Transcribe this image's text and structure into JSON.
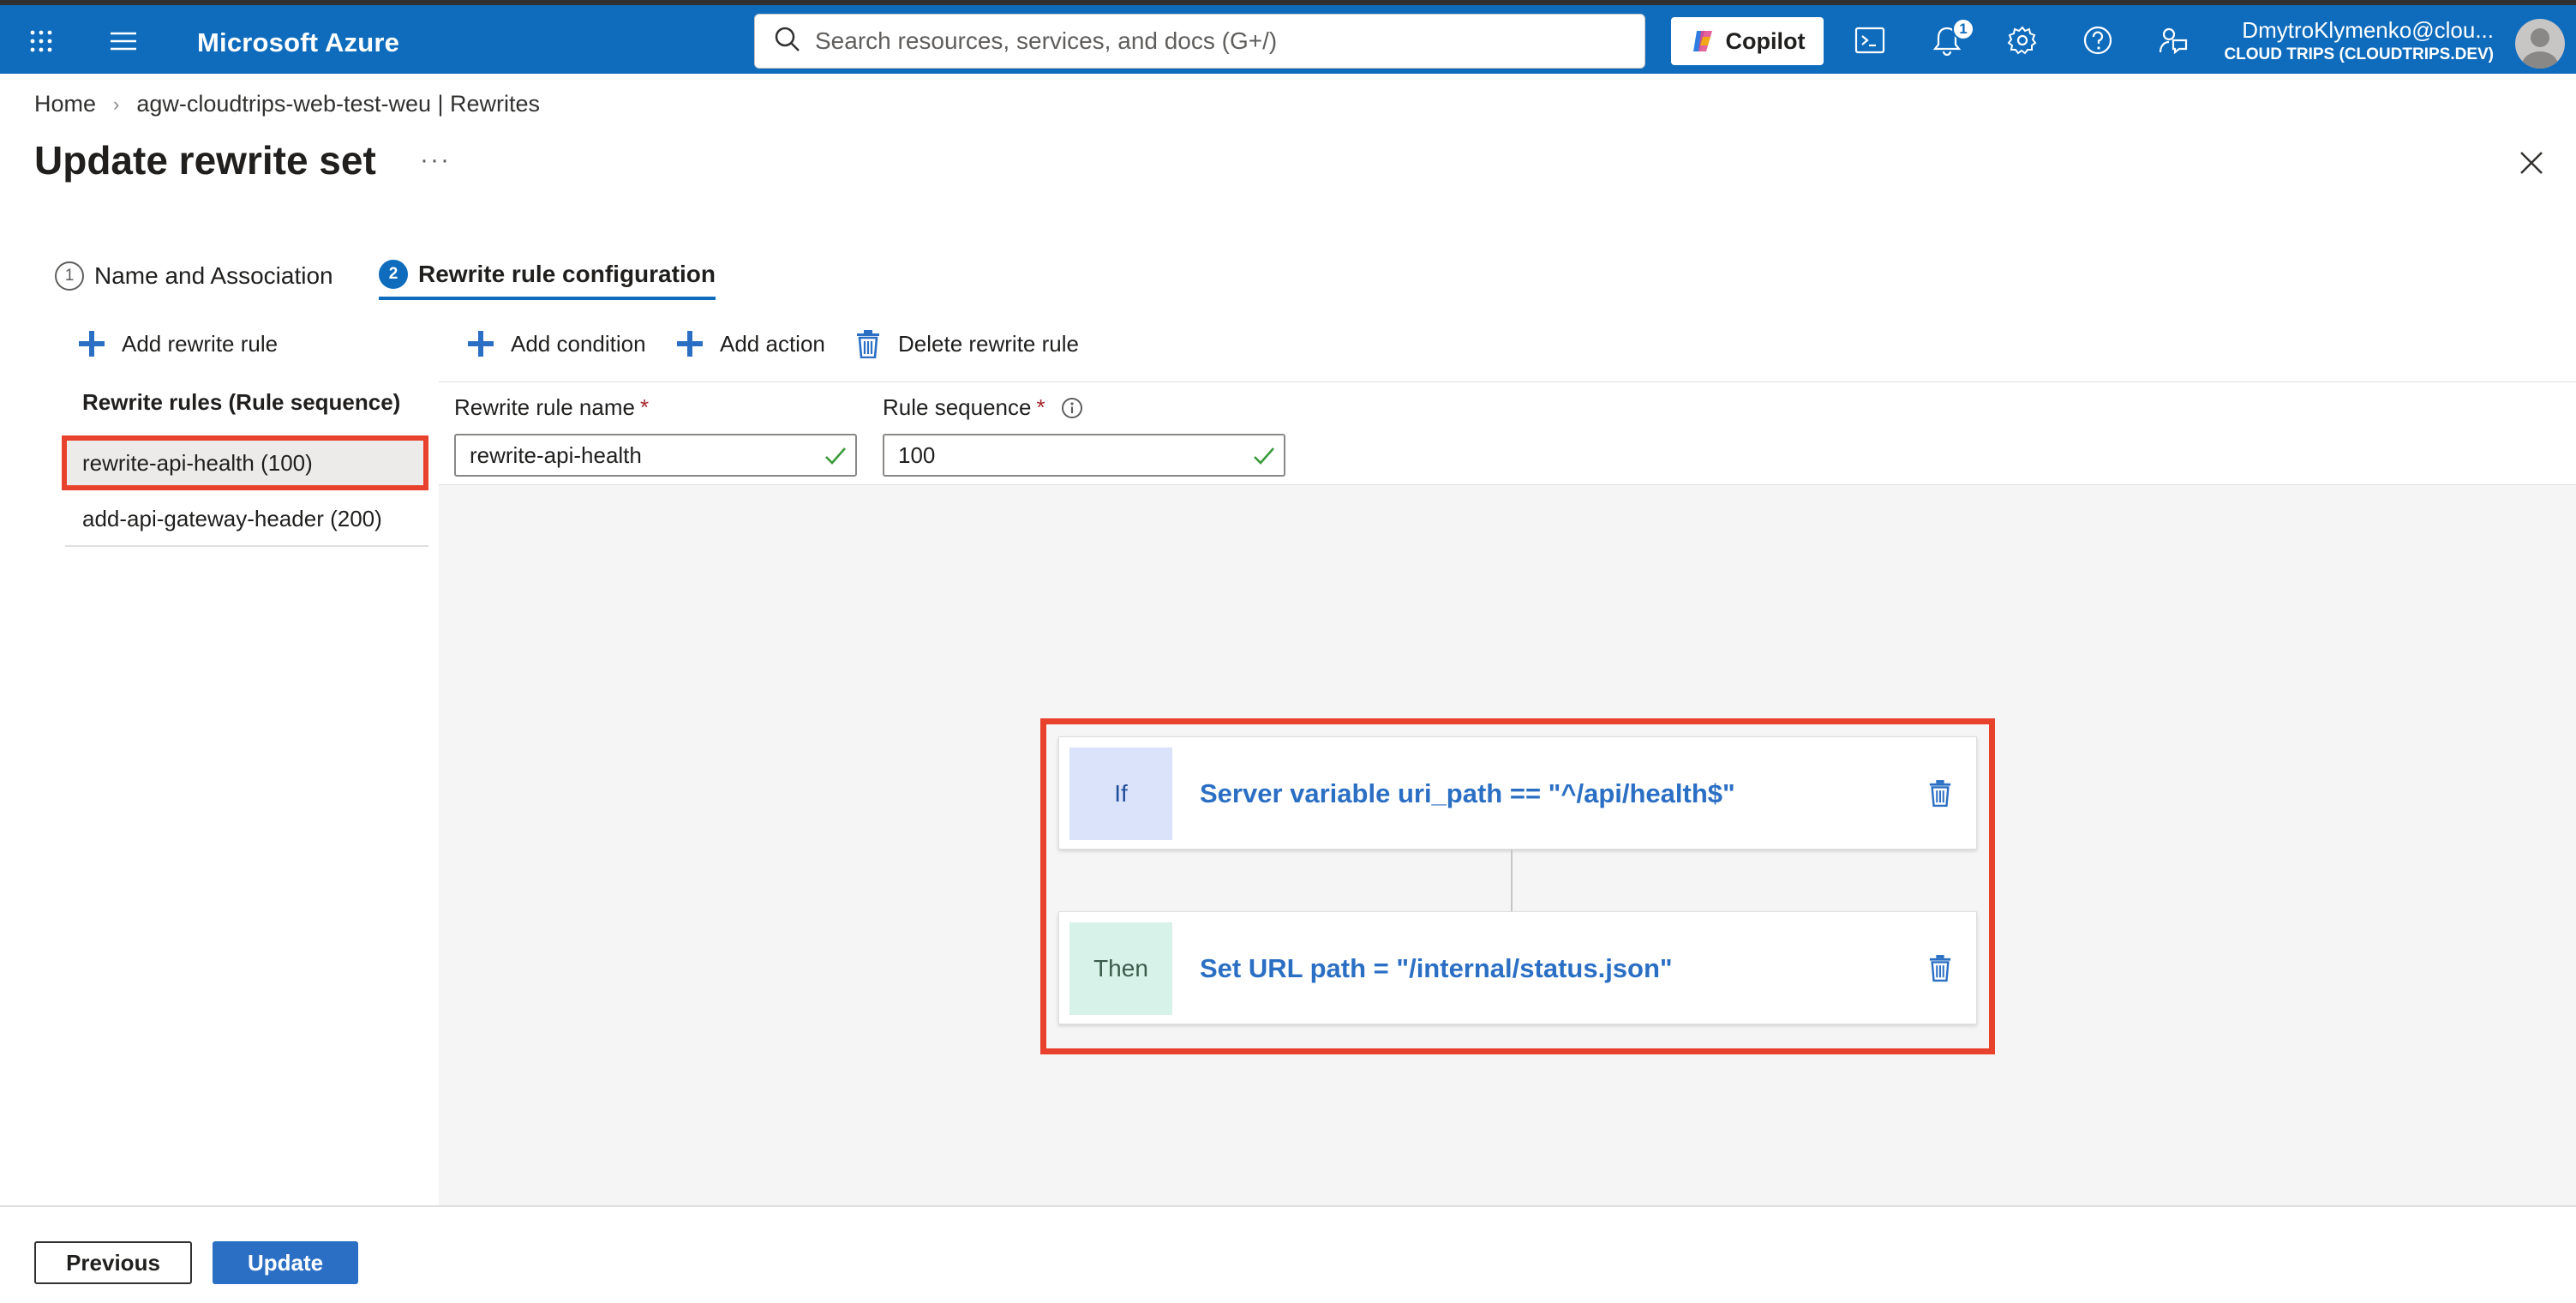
{
  "topbar": {
    "brand": "Microsoft Azure",
    "search_placeholder": "Search resources, services, and docs (G+/)",
    "copilot_label": "Copilot",
    "notification_count": "1",
    "account_email": "DmytroKlymenko@clou...",
    "account_tenant": "CLOUD TRIPS (CLOUDTRIPS.DEV)"
  },
  "breadcrumb": {
    "items": [
      "Home",
      "agw-cloudtrips-web-test-weu | Rewrites"
    ]
  },
  "page": {
    "title": "Update rewrite set",
    "more": "···"
  },
  "tabs": [
    {
      "number": "1",
      "label": "Name and Association"
    },
    {
      "number": "2",
      "label": "Rewrite rule configuration"
    }
  ],
  "left_panel": {
    "add_rule_label": "Add rewrite rule",
    "rules_header": "Rewrite rules (Rule sequence)",
    "rules": [
      {
        "label": "rewrite-api-health (100)"
      },
      {
        "label": "add-api-gateway-header (200)"
      }
    ]
  },
  "commands": {
    "add_condition": "Add condition",
    "add_action": "Add action",
    "delete_rule": "Delete rewrite rule"
  },
  "form": {
    "rule_name_label": "Rewrite rule name",
    "rule_name_value": "rewrite-api-health",
    "rule_sequence_label": "Rule sequence",
    "rule_sequence_value": "100",
    "required_mark": "*"
  },
  "flow": {
    "if_tag": "If",
    "if_text": "Server variable uri_path == \"^/api/health$\"",
    "then_tag": "Then",
    "then_text": "Set URL path = \"/internal/status.json\""
  },
  "footer": {
    "previous_label": "Previous",
    "update_label": "Update"
  },
  "colors": {
    "topbar": "#0f6cbd",
    "accent": "#2b6fc4",
    "highlight_box": "#e8412c",
    "valid_check": "#3a9a3a"
  }
}
